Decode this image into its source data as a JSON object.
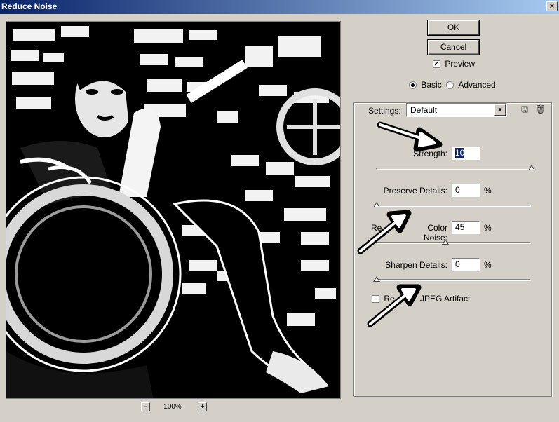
{
  "window": {
    "title": "Reduce Noise",
    "close_label": "×"
  },
  "buttons": {
    "ok": "OK",
    "cancel": "Cancel"
  },
  "preview_checkbox": {
    "label": "Preview",
    "checked": true
  },
  "mode": {
    "basic": "Basic",
    "advanced": "Advanced",
    "selected": "basic"
  },
  "settings": {
    "label": "Settings:",
    "value": "Default"
  },
  "controls": {
    "strength": {
      "label": "Strength:",
      "value": "10",
      "max": 10
    },
    "preserve_details": {
      "label": "Preserve Details:",
      "value": "0",
      "unit": "%",
      "max": 100
    },
    "reduce_color_noise": {
      "label_left": "Re",
      "label_right": "Color Noise:",
      "value": "45",
      "unit": "%",
      "max": 100
    },
    "sharpen_details": {
      "label": "Sharpen Details:",
      "value": "0",
      "unit": "%",
      "max": 100
    }
  },
  "jpeg_artifact": {
    "label_left": "Re",
    "label_right": "JPEG Artifact",
    "checked": false
  },
  "zoom": {
    "minus": "-",
    "level": "100%",
    "plus": "+"
  },
  "icons": {
    "save_settings": "save-disk-icon",
    "delete_settings": "trash-icon"
  }
}
